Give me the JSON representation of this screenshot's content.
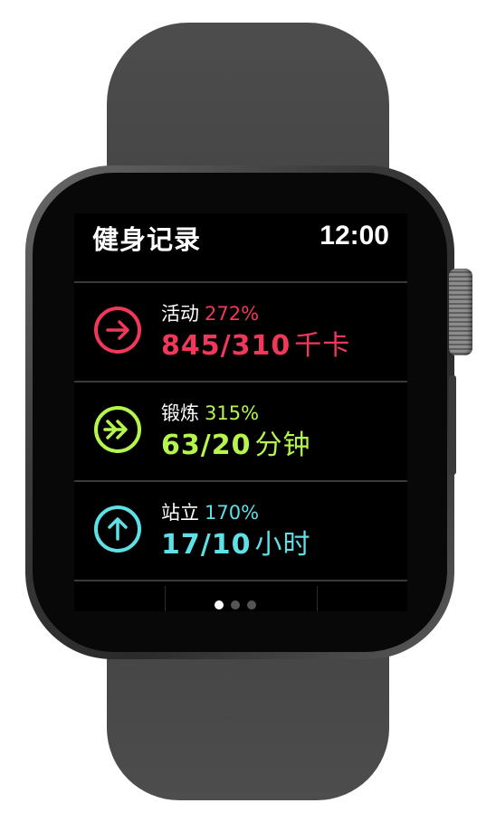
{
  "app": {
    "title": "健身记录",
    "time": "12:00"
  },
  "colors": {
    "move": "#f2385a",
    "exercise": "#b6f54d",
    "stand": "#5ee0e6"
  },
  "rows": [
    {
      "label": "活动",
      "percent": "272%",
      "value": "845/310",
      "unit": "千卡",
      "icon": "move-arrow-icon"
    },
    {
      "label": "锻炼",
      "percent": "315%",
      "value": "63/20",
      "unit": "分钟",
      "icon": "exercise-double-arrow-icon"
    },
    {
      "label": "站立",
      "percent": "170%",
      "value": "17/10",
      "unit": "小时",
      "icon": "stand-up-arrow-icon"
    }
  ],
  "pagination": {
    "pages": 3,
    "current": 1
  }
}
